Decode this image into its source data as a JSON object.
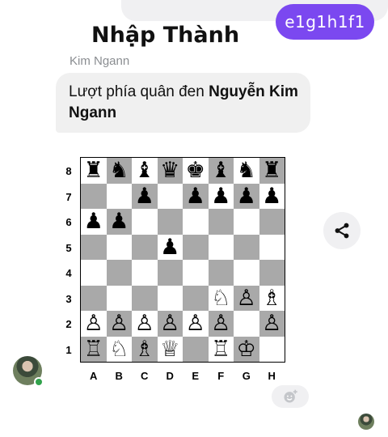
{
  "sent_message": {
    "text": "e1g1h1f1"
  },
  "title": "Nhập Thành",
  "received": {
    "sender": "Kim Ngann",
    "text_prefix": "Lượt phía quân đen ",
    "text_bold": "Nguyễn Kim Ngann"
  },
  "board": {
    "rank_labels": [
      "8",
      "7",
      "6",
      "5",
      "4",
      "3",
      "2",
      "1"
    ],
    "file_labels": [
      "A",
      "B",
      "C",
      "D",
      "E",
      "F",
      "G",
      "H"
    ],
    "rows": [
      [
        "♜",
        "♞",
        "♝",
        "♛",
        "♚",
        "♝",
        "♞",
        "♜"
      ],
      [
        "",
        "",
        "♟",
        "",
        "♟",
        "♟",
        "♟",
        "♟"
      ],
      [
        "♟",
        "♟",
        "",
        "",
        "",
        "",
        "",
        ""
      ],
      [
        "",
        "",
        "",
        "♟",
        "",
        "",
        "",
        ""
      ],
      [
        "",
        "",
        "",
        "",
        "",
        "",
        "",
        ""
      ],
      [
        "",
        "",
        "",
        "",
        "",
        "♘",
        "♙",
        "♗"
      ],
      [
        "♙",
        "♙",
        "♙",
        "♙",
        "♙",
        "♙",
        "",
        "♙"
      ],
      [
        "♖",
        "♘",
        "♗",
        "♕",
        "",
        "♖",
        "♔",
        ""
      ]
    ]
  },
  "icons": {
    "share": "share-icon",
    "react": "add-reaction-icon",
    "avatar": "avatar"
  },
  "colors": {
    "accent": "#7b48f0",
    "bubble": "#f0f0f0",
    "online": "#31a24c"
  }
}
